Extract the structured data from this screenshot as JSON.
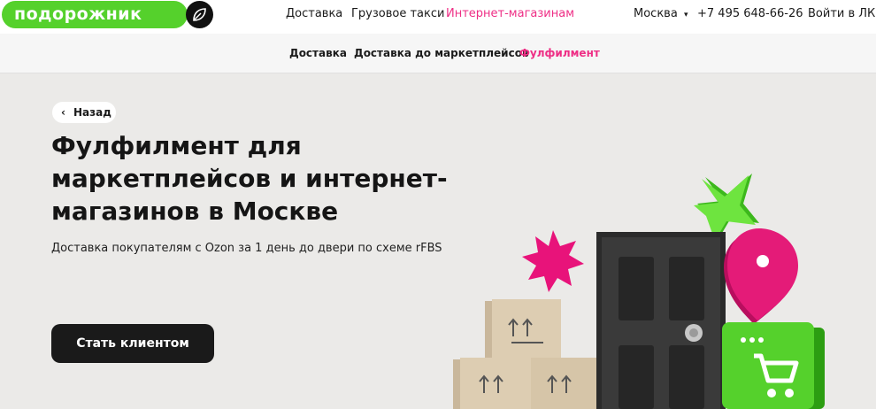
{
  "header": {
    "logo_text": "подорожник",
    "nav": [
      "Доставка",
      "Грузовое такси",
      "Интернет-магазинам"
    ],
    "city": "Москва",
    "city_caret": "▾",
    "phone": "+7 495 648-66-26",
    "login": "Войти в ЛК"
  },
  "subnav": [
    "Доставка",
    "Доставка до маркетплейсов",
    "Фулфилмент"
  ],
  "hero": {
    "back": "Назад",
    "back_icon": "chevron-left-icon",
    "title": "Фулфилмент для маркетплейсов и интернет-магазинов в Москве",
    "subtitle": "Доставка покупателям с Ozon за 1 день до двери по схеме rFBS",
    "cta": "Стать клиентом"
  },
  "colors": {
    "brand_green": "#55d12c",
    "accent_pink": "#ee2e85",
    "dark": "#1a1a1a"
  }
}
